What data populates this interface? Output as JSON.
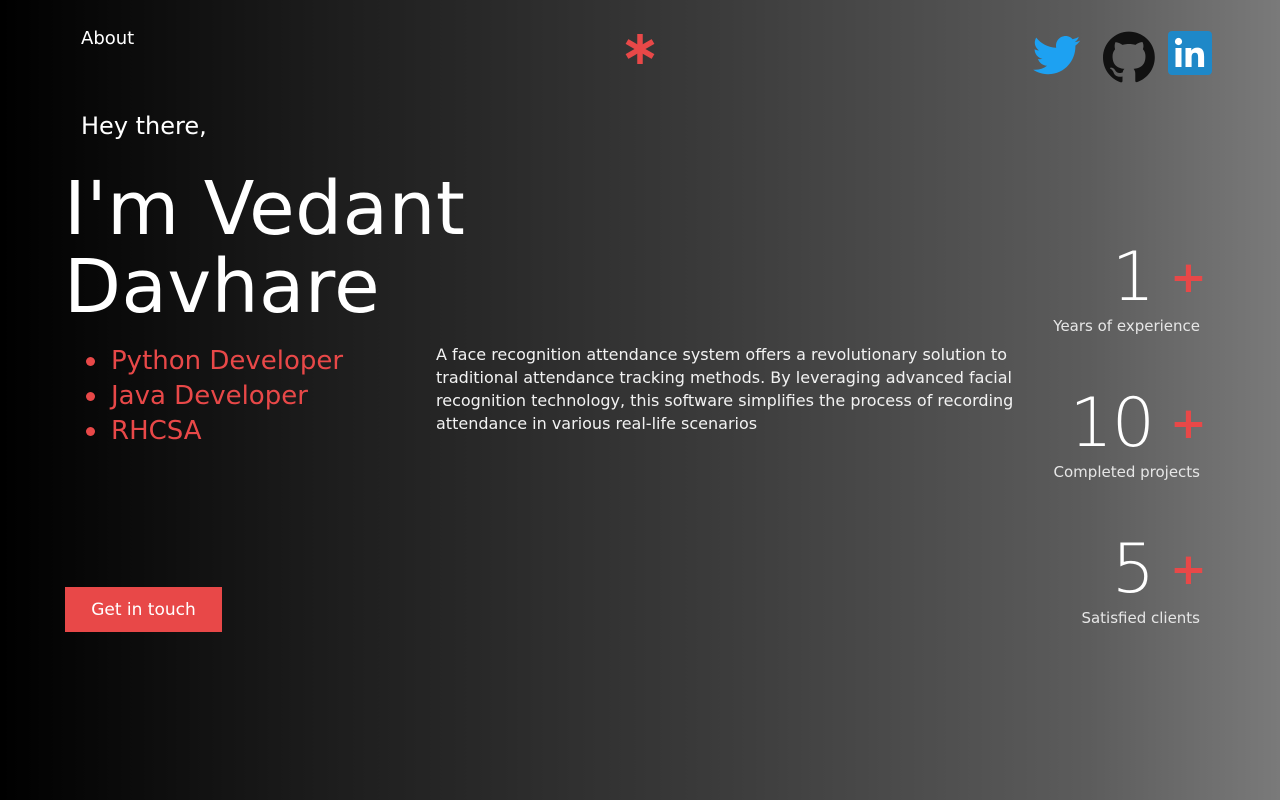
{
  "nav": {
    "about_label": "About"
  },
  "logo": {
    "icon": "asterisk-icon",
    "color": "#e84848"
  },
  "social": [
    {
      "icon": "twitter-icon",
      "color": "#1da1f2"
    },
    {
      "icon": "github-icon",
      "color": "#111111"
    },
    {
      "icon": "linkedin-icon",
      "color": "#1e88c8"
    }
  ],
  "hero": {
    "greeting": "Hey there,",
    "name_line1": "I'm Vedant",
    "name_line2": "Davhare",
    "roles": [
      "Python Developer",
      "Java Developer",
      "RHCSA"
    ],
    "description": "A face recognition attendance system offers a revolutionary solution to traditional attendance tracking methods. By leveraging advanced facial recognition technology, this software simplifies the process of recording attendance in various real-life scenarios",
    "cta_label": "Get in touch"
  },
  "stats": [
    {
      "value": "1",
      "plus": "+",
      "label": "Years of experience"
    },
    {
      "value": "10",
      "plus": "+",
      "label": "Completed projects"
    },
    {
      "value": "5",
      "plus": "+",
      "label": "Satisfied clients"
    }
  ],
  "colors": {
    "accent": "#e84848",
    "text": "#ffffff"
  }
}
